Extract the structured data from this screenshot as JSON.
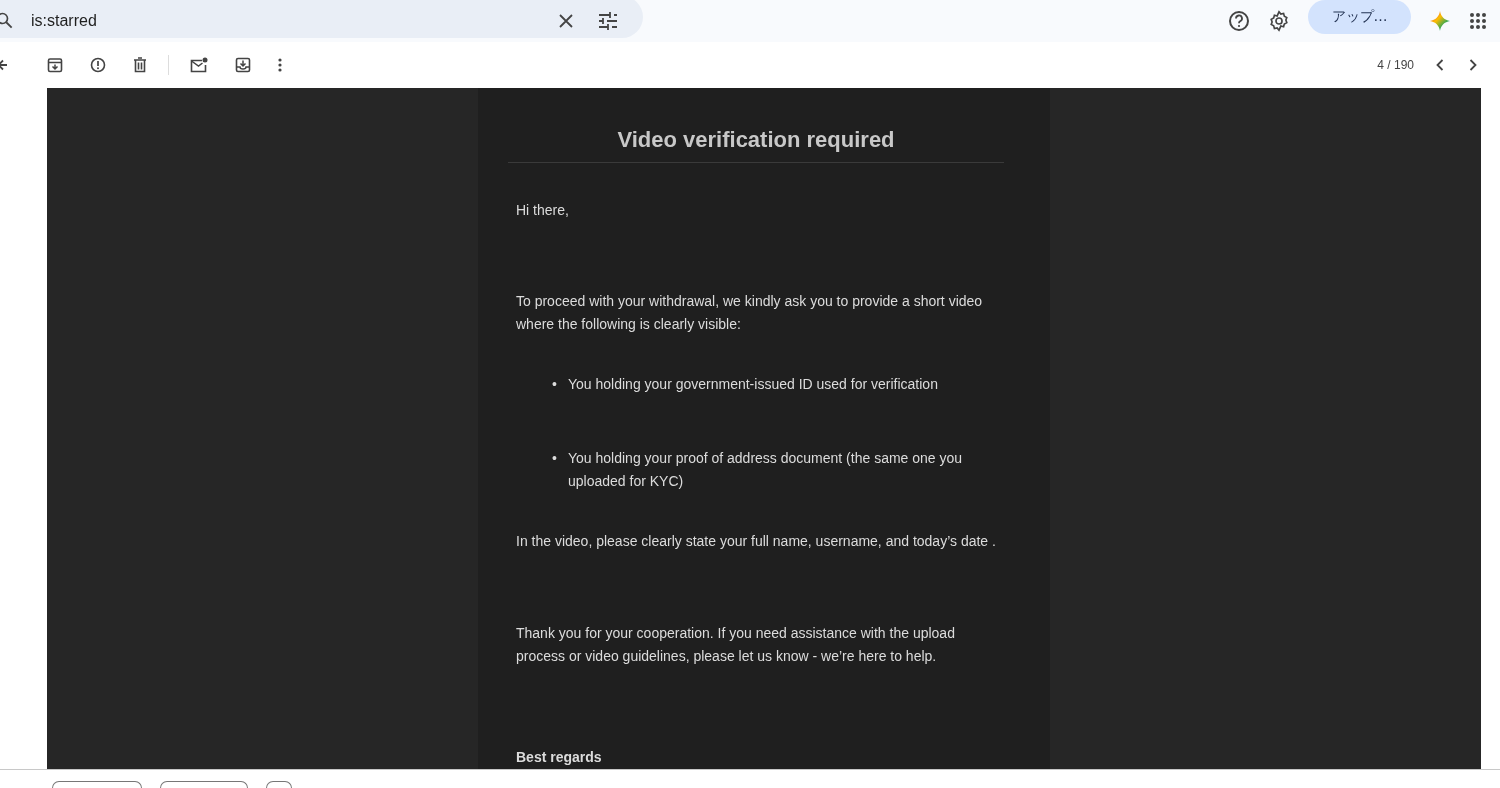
{
  "search": {
    "value": "is:starred"
  },
  "account_button": {
    "label": "アップ…"
  },
  "toolbar": {
    "counter": "4 / 190"
  },
  "email": {
    "title": "Video verification required",
    "blocks": [
      {
        "kind": "paragraph",
        "text": "Hi there,"
      },
      {
        "kind": "paragraph",
        "text": "To proceed with your withdrawal, we kindly ask you to provide a short video where the following is clearly visible:"
      },
      {
        "kind": "list",
        "items": [
          {
            "bullet": "•",
            "text": "You holding your government-issued ID used for verification"
          },
          {
            "bullet": "•",
            "text": "You holding your proof of address document (the same one you uploaded for KYC)"
          }
        ]
      },
      {
        "kind": "paragraph",
        "text": "In the video, please clearly state your full name, username, and today’s date ."
      },
      {
        "kind": "paragraph",
        "text": "Thank you for your cooperation. If you need assistance with the upload process or video guidelines, please let us know - we’re here to help."
      },
      {
        "kind": "signoff",
        "text": "Best regards"
      }
    ]
  }
}
